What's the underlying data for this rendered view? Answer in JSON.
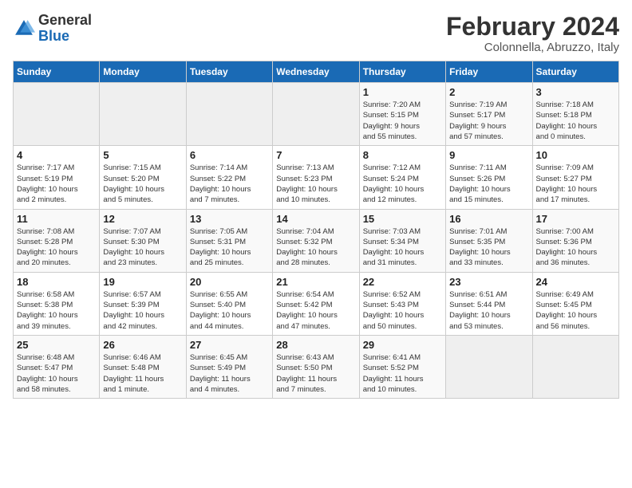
{
  "logo": {
    "line1": "General",
    "line2": "Blue"
  },
  "title": "February 2024",
  "subtitle": "Colonnella, Abruzzo, Italy",
  "days_of_week": [
    "Sunday",
    "Monday",
    "Tuesday",
    "Wednesday",
    "Thursday",
    "Friday",
    "Saturday"
  ],
  "weeks": [
    [
      {
        "day": "",
        "info": ""
      },
      {
        "day": "",
        "info": ""
      },
      {
        "day": "",
        "info": ""
      },
      {
        "day": "",
        "info": ""
      },
      {
        "day": "1",
        "info": "Sunrise: 7:20 AM\nSunset: 5:15 PM\nDaylight: 9 hours\nand 55 minutes."
      },
      {
        "day": "2",
        "info": "Sunrise: 7:19 AM\nSunset: 5:17 PM\nDaylight: 9 hours\nand 57 minutes."
      },
      {
        "day": "3",
        "info": "Sunrise: 7:18 AM\nSunset: 5:18 PM\nDaylight: 10 hours\nand 0 minutes."
      }
    ],
    [
      {
        "day": "4",
        "info": "Sunrise: 7:17 AM\nSunset: 5:19 PM\nDaylight: 10 hours\nand 2 minutes."
      },
      {
        "day": "5",
        "info": "Sunrise: 7:15 AM\nSunset: 5:20 PM\nDaylight: 10 hours\nand 5 minutes."
      },
      {
        "day": "6",
        "info": "Sunrise: 7:14 AM\nSunset: 5:22 PM\nDaylight: 10 hours\nand 7 minutes."
      },
      {
        "day": "7",
        "info": "Sunrise: 7:13 AM\nSunset: 5:23 PM\nDaylight: 10 hours\nand 10 minutes."
      },
      {
        "day": "8",
        "info": "Sunrise: 7:12 AM\nSunset: 5:24 PM\nDaylight: 10 hours\nand 12 minutes."
      },
      {
        "day": "9",
        "info": "Sunrise: 7:11 AM\nSunset: 5:26 PM\nDaylight: 10 hours\nand 15 minutes."
      },
      {
        "day": "10",
        "info": "Sunrise: 7:09 AM\nSunset: 5:27 PM\nDaylight: 10 hours\nand 17 minutes."
      }
    ],
    [
      {
        "day": "11",
        "info": "Sunrise: 7:08 AM\nSunset: 5:28 PM\nDaylight: 10 hours\nand 20 minutes."
      },
      {
        "day": "12",
        "info": "Sunrise: 7:07 AM\nSunset: 5:30 PM\nDaylight: 10 hours\nand 23 minutes."
      },
      {
        "day": "13",
        "info": "Sunrise: 7:05 AM\nSunset: 5:31 PM\nDaylight: 10 hours\nand 25 minutes."
      },
      {
        "day": "14",
        "info": "Sunrise: 7:04 AM\nSunset: 5:32 PM\nDaylight: 10 hours\nand 28 minutes."
      },
      {
        "day": "15",
        "info": "Sunrise: 7:03 AM\nSunset: 5:34 PM\nDaylight: 10 hours\nand 31 minutes."
      },
      {
        "day": "16",
        "info": "Sunrise: 7:01 AM\nSunset: 5:35 PM\nDaylight: 10 hours\nand 33 minutes."
      },
      {
        "day": "17",
        "info": "Sunrise: 7:00 AM\nSunset: 5:36 PM\nDaylight: 10 hours\nand 36 minutes."
      }
    ],
    [
      {
        "day": "18",
        "info": "Sunrise: 6:58 AM\nSunset: 5:38 PM\nDaylight: 10 hours\nand 39 minutes."
      },
      {
        "day": "19",
        "info": "Sunrise: 6:57 AM\nSunset: 5:39 PM\nDaylight: 10 hours\nand 42 minutes."
      },
      {
        "day": "20",
        "info": "Sunrise: 6:55 AM\nSunset: 5:40 PM\nDaylight: 10 hours\nand 44 minutes."
      },
      {
        "day": "21",
        "info": "Sunrise: 6:54 AM\nSunset: 5:42 PM\nDaylight: 10 hours\nand 47 minutes."
      },
      {
        "day": "22",
        "info": "Sunrise: 6:52 AM\nSunset: 5:43 PM\nDaylight: 10 hours\nand 50 minutes."
      },
      {
        "day": "23",
        "info": "Sunrise: 6:51 AM\nSunset: 5:44 PM\nDaylight: 10 hours\nand 53 minutes."
      },
      {
        "day": "24",
        "info": "Sunrise: 6:49 AM\nSunset: 5:45 PM\nDaylight: 10 hours\nand 56 minutes."
      }
    ],
    [
      {
        "day": "25",
        "info": "Sunrise: 6:48 AM\nSunset: 5:47 PM\nDaylight: 10 hours\nand 58 minutes."
      },
      {
        "day": "26",
        "info": "Sunrise: 6:46 AM\nSunset: 5:48 PM\nDaylight: 11 hours\nand 1 minute."
      },
      {
        "day": "27",
        "info": "Sunrise: 6:45 AM\nSunset: 5:49 PM\nDaylight: 11 hours\nand 4 minutes."
      },
      {
        "day": "28",
        "info": "Sunrise: 6:43 AM\nSunset: 5:50 PM\nDaylight: 11 hours\nand 7 minutes."
      },
      {
        "day": "29",
        "info": "Sunrise: 6:41 AM\nSunset: 5:52 PM\nDaylight: 11 hours\nand 10 minutes."
      },
      {
        "day": "",
        "info": ""
      },
      {
        "day": "",
        "info": ""
      }
    ]
  ]
}
